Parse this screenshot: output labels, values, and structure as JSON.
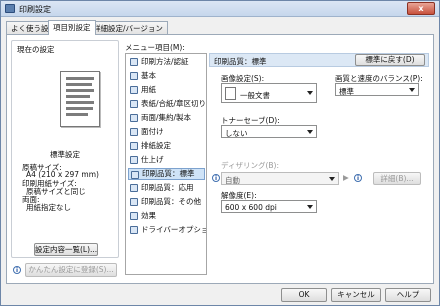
{
  "window": {
    "title": "印刷設定",
    "close_label": "x"
  },
  "tabs": [
    {
      "label": "よく使う設定"
    },
    {
      "label": "項目別設定"
    },
    {
      "label": "詳細設定/バージョン"
    }
  ],
  "left": {
    "current_settings_label": "現在の設定",
    "setting_name": "標準設定",
    "details": [
      "原稿サイズ:",
      "A4 (210 x 297 mm)",
      "印刷用紙サイズ:",
      "原稿サイズと同じ",
      "両面:",
      "用紙指定なし"
    ],
    "list_button": "設定内容一覧(L)...",
    "register_button": "かんたん設定に登録(S)..."
  },
  "menu": {
    "title": "メニュー項目(M):",
    "items": [
      {
        "label": "印刷方法/認証",
        "icon": "lock-icon"
      },
      {
        "label": "基本",
        "icon": "document-icon"
      },
      {
        "label": "用紙",
        "icon": "paper-icon"
      },
      {
        "label": "表紙/合紙/章区切り",
        "icon": "cover-icon"
      },
      {
        "label": "両面/集約/製本",
        "icon": "duplex-icon"
      },
      {
        "label": "面付け",
        "icon": "layout-icon"
      },
      {
        "label": "排紙設定",
        "icon": "output-icon"
      },
      {
        "label": "仕上げ",
        "icon": "finish-icon"
      },
      {
        "label": "印刷品質：標準",
        "icon": "quality-icon"
      },
      {
        "label": "印刷品質：応用",
        "icon": "quality-advanced-icon"
      },
      {
        "label": "印刷品質：その他",
        "icon": "quality-other-icon"
      },
      {
        "label": "効果",
        "icon": "effect-icon"
      },
      {
        "label": "ドライバーオプション",
        "icon": "gear-icon"
      }
    ],
    "selected_index": 8
  },
  "main": {
    "header": "印刷品質：標準",
    "restore_button": "標準に戻す(D)",
    "image_setting_label": "画像設定(S):",
    "image_setting_value": "一般文書",
    "balance_label": "画質と速度のバランス(P):",
    "balance_value": "標準",
    "toner_label": "トナーセーブ(D):",
    "toner_value": "しない",
    "dither_label": "ディザリング(B):",
    "dither_value": "自動",
    "detail_button": "詳細(B)...",
    "resolution_label": "解像度(E):",
    "resolution_value": "600 x 600 dpi"
  },
  "footer": {
    "ok": "OK",
    "cancel": "キャンセル",
    "help": "ヘルプ"
  }
}
